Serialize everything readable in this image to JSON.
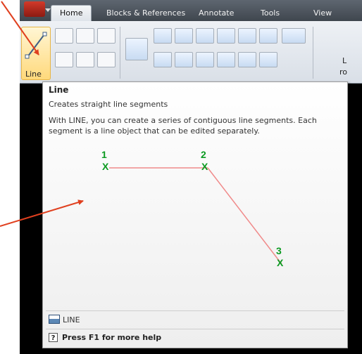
{
  "ribbon": {
    "tabs": [
      {
        "label": "Home",
        "active": true
      },
      {
        "label": "Blocks & References",
        "active": false
      },
      {
        "label": "Annotate",
        "active": false
      },
      {
        "label": "Tools",
        "active": false
      },
      {
        "label": "View",
        "active": false
      }
    ],
    "line_tool_label": "Line",
    "right_labels": [
      "L",
      "ro"
    ]
  },
  "tooltip": {
    "title": "Line",
    "short_description": "Creates straight line segments",
    "long_description": "With LINE, you can create a series of contiguous line segments. Each segment is a line object that can be edited separately.",
    "point_labels": [
      "1",
      "2",
      "3"
    ],
    "point_marker": "X",
    "command_name": "LINE",
    "help_key": "?",
    "help_text": "Press F1 for more help"
  },
  "colors": {
    "callout_arrow": "#e0401f",
    "point_marker": "#0b9a21",
    "segment_line": "#f08a8a",
    "tooltip_bg": "#ffffff",
    "tooltip_border": "#9a9a9a"
  }
}
